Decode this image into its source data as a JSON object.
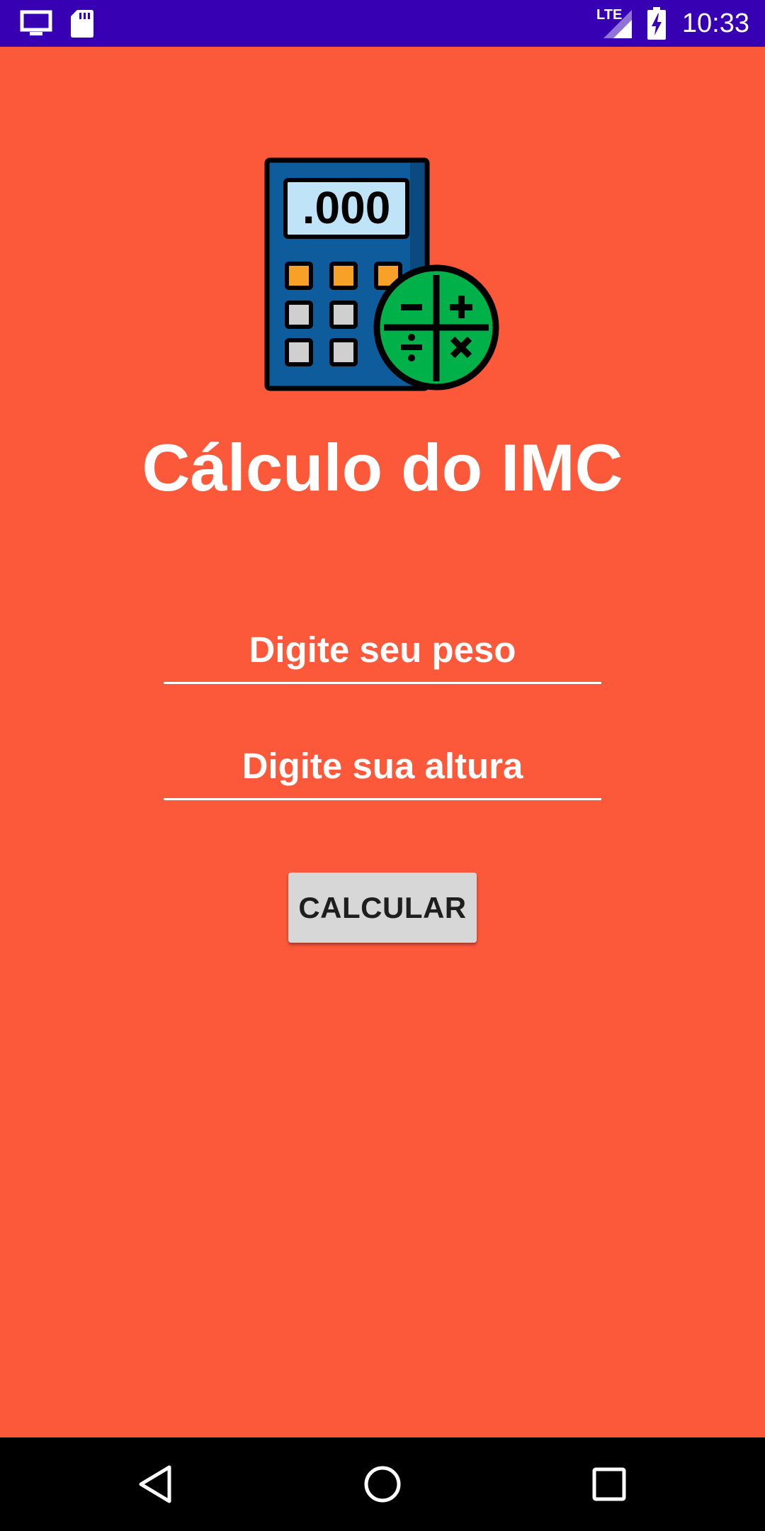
{
  "status_bar": {
    "time": "10:33",
    "network_label": "LTE",
    "icons": [
      "monitor-icon",
      "sd-card-icon",
      "signal-icon",
      "battery-charging-icon"
    ],
    "background_color": "#3700B3"
  },
  "app": {
    "title": "Cálculo do IMC",
    "logo_icon": "calculator-math-icon",
    "logo_display": ".000",
    "background_color": "#FC593A"
  },
  "form": {
    "weight_placeholder": "Digite seu peso",
    "height_placeholder": "Digite sua altura",
    "calculate_label": "CALCULAR"
  },
  "nav_bar": {
    "buttons": [
      "back-icon",
      "home-icon",
      "recents-icon"
    ]
  }
}
